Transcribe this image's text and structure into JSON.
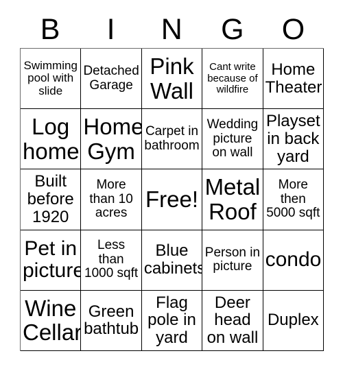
{
  "header": {
    "letters": [
      "B",
      "I",
      "N",
      "G",
      "O"
    ]
  },
  "grid": {
    "rows": [
      [
        {
          "text": "Swimming pool with slide",
          "size": "sz-s"
        },
        {
          "text": "Detached Garage",
          "size": "sz-m"
        },
        {
          "text": "Pink Wall",
          "size": "sz-xxl"
        },
        {
          "text": "Cant write because of wildfire",
          "size": "sz-xs"
        },
        {
          "text": "Home Theater",
          "size": "sz-l"
        }
      ],
      [
        {
          "text": "Log home",
          "size": "sz-xxl"
        },
        {
          "text": "Home Gym",
          "size": "sz-xxl"
        },
        {
          "text": "Carpet in bathroom",
          "size": "sz-m"
        },
        {
          "text": "Wedding picture on wall",
          "size": "sz-m"
        },
        {
          "text": "Playset in back yard",
          "size": "sz-l"
        }
      ],
      [
        {
          "text": "Built before 1920",
          "size": "sz-l"
        },
        {
          "text": "More than 10 acres",
          "size": "sz-m"
        },
        {
          "text": "Free!",
          "size": "sz-xxl"
        },
        {
          "text": "Metal Roof",
          "size": "sz-xxl"
        },
        {
          "text": "More then 5000 sqft",
          "size": "sz-m"
        }
      ],
      [
        {
          "text": "Pet in picture",
          "size": "sz-xl"
        },
        {
          "text": "Less than 1000 sqft",
          "size": "sz-m"
        },
        {
          "text": "Blue cabinets",
          "size": "sz-l"
        },
        {
          "text": "Person in picture",
          "size": "sz-m"
        },
        {
          "text": "condo",
          "size": "sz-xl"
        }
      ],
      [
        {
          "text": "Wine Cellar",
          "size": "sz-xxl"
        },
        {
          "text": "Green bathtub",
          "size": "sz-l"
        },
        {
          "text": "Flag pole in yard",
          "size": "sz-l"
        },
        {
          "text": "Deer head on wall",
          "size": "sz-l"
        },
        {
          "text": "Duplex",
          "size": "sz-l"
        }
      ]
    ]
  }
}
